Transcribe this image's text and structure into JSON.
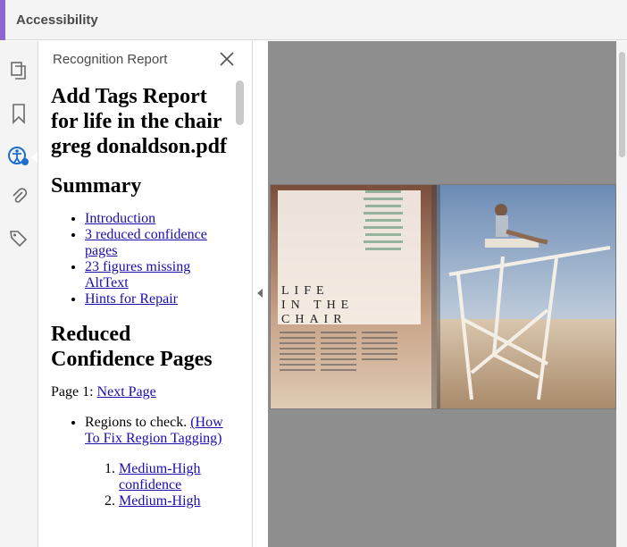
{
  "app": {
    "title": "Accessibility",
    "accent": "#8c65d3"
  },
  "rail": {
    "icons": [
      "pages-icon",
      "bookmark-icon",
      "accessibility-icon",
      "attachment-icon",
      "tags-icon"
    ],
    "active": "accessibility-icon"
  },
  "panel": {
    "title": "Recognition Report"
  },
  "report": {
    "heading": "Add Tags Report for life in the chair greg donaldson.pdf",
    "summary_title": "Summary",
    "summary_links": [
      "Introduction",
      "3 reduced confidence pages",
      "23 figures missing AltText",
      "Hints for Repair"
    ],
    "reduced_title": "Reduced Confidence Pages",
    "page_label": "Page 1:",
    "next_page": "Next Page",
    "regions_text": "Regions to check.",
    "how_to_fix": "(How To Fix Region Tagging)",
    "confidence_items": [
      "Medium-High confidence",
      "Medium-High"
    ]
  },
  "document": {
    "spread_text_line1": "LIFE",
    "spread_text_line2": "IN THE",
    "spread_text_line3": "CHAIR"
  }
}
